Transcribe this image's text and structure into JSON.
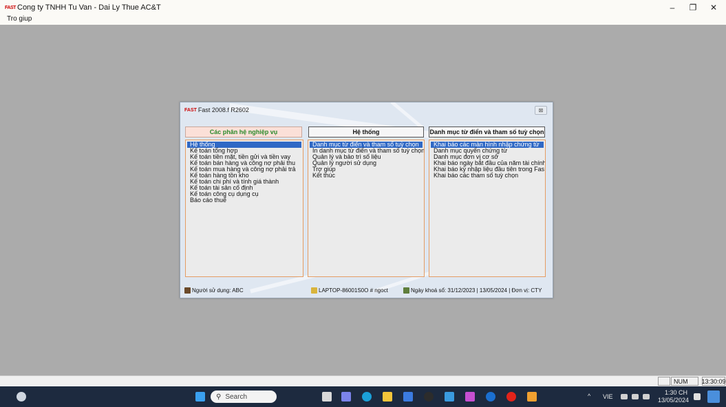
{
  "window": {
    "logo_text": "FAST",
    "title": "Cong ty TNHH Tu Van - Dai Ly Thue AC&T",
    "minimize": "–",
    "restore": "❐",
    "close": "✕"
  },
  "menu": {
    "help": "Tro giup"
  },
  "dialog": {
    "logo_text": "FAST",
    "title": "Fast 2008.f R2602",
    "close": "⊠",
    "columns": [
      {
        "header": "Các phân hệ nghiệp vụ",
        "items": [
          "Hệ thống",
          "Kế toán tổng hợp",
          "Kế toán tiền mặt, tiền gửi và tiền vay",
          "Kế toán bán hàng và công nợ phải thu",
          "Kế toán mua hàng và công nợ phải trả",
          "Kế toán hàng tồn kho",
          "Kế toán chi phí và tính giá thành",
          "Kế toán tài sản cố định",
          "Kế toán công cụ dụng cụ",
          "Báo cáo thuế"
        ]
      },
      {
        "header": "Hệ thống",
        "items": [
          "Danh mục từ điển và tham số tuỳ chọn",
          "In danh mục từ điển và tham số tuỳ chọn",
          "Quản lý và bảo trì số liệu",
          "Quản lý người sử dụng",
          "Trợ giúp",
          "Kết thúc"
        ]
      },
      {
        "header": "Danh mục từ điển và tham số tuỳ chọn",
        "items": [
          "Khai báo các màn hình nhập chứng từ",
          "Danh mục quyển chứng từ",
          "Danh mục đơn vị cơ sở",
          "Khai báo ngày bắt đầu của năm tài chính",
          "Khai báo kỳ nhập liệu đầu tiên trong Fas",
          "Khai báo các tham số tuỳ chọn"
        ]
      }
    ],
    "status": {
      "user": "Người sử dụng: ABC",
      "computer": "LAPTOP-86001S0O # ngoct",
      "lock_info": "Ngày khoá sổ: 31/12/2023 | 13/05/2024 | Đơn vị: CTY"
    }
  },
  "appstatus": {
    "num": "NUM",
    "time": "13:30:09"
  },
  "taskbar": {
    "search_placeholder": "Search",
    "language": "VIE",
    "clock_time": "1:30 CH",
    "clock_date": "13/05/2024",
    "tray_up": "^"
  },
  "colors": {
    "selection": "#2f68c5",
    "header_active_bg": "#fbe0d8",
    "header_active_text": "#2a8a2a",
    "taskbar": "#1d2a3f"
  }
}
